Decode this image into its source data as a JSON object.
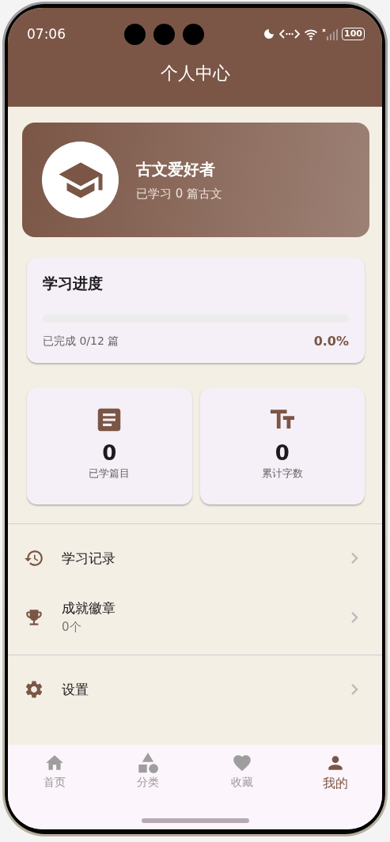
{
  "status_bar": {
    "time": "07:06",
    "battery": "100"
  },
  "header": {
    "title": "个人中心"
  },
  "profile": {
    "name": "古文爱好者",
    "subtitle": "已学习 0 篇古文"
  },
  "progress": {
    "title": "学习进度",
    "level": 0,
    "caption": "已完成 0/12 篇",
    "percent": "0.0%"
  },
  "stats": [
    {
      "kind": "article",
      "value": "0",
      "label": "已学篇目"
    },
    {
      "kind": "text",
      "value": "0",
      "label": "累计字数"
    }
  ],
  "menu_groups": [
    [
      {
        "kind": "history",
        "label": "学习记录"
      },
      {
        "kind": "trophy",
        "label": "成就徽章",
        "detail": "0个"
      }
    ],
    [
      {
        "kind": "settings",
        "label": "设置"
      }
    ]
  ],
  "nav": [
    {
      "kind": "home",
      "label": "首页",
      "selected": false
    },
    {
      "kind": "category",
      "label": "分类",
      "selected": false
    },
    {
      "kind": "heart",
      "label": "收藏",
      "selected": false
    },
    {
      "kind": "person",
      "label": "我的",
      "selected": true
    }
  ]
}
